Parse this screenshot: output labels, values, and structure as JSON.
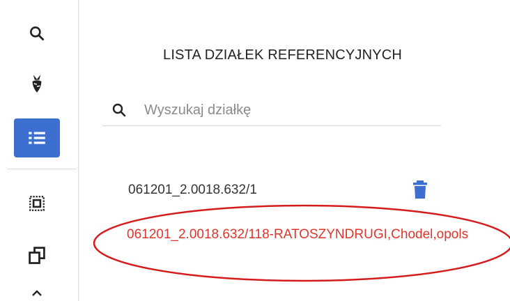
{
  "sidebar": {
    "items": [
      {
        "icon": "search-icon"
      },
      {
        "icon": "beet-icon"
      },
      {
        "icon": "list-icon",
        "active": true
      },
      {
        "icon": "select-area-icon"
      },
      {
        "icon": "duplicate-icon"
      }
    ]
  },
  "panel": {
    "title": "LISTA DZIAŁEK REFERENCYJNYCH",
    "search": {
      "placeholder": "Wyszukaj działkę",
      "value": ""
    },
    "items": [
      {
        "label": "061201_2.0018.632/1"
      },
      {
        "label": "061201_2.0018.632/118-RATOSZYNDRUGI,Chodel,opols"
      }
    ]
  },
  "colors": {
    "accent": "#3d6fd1",
    "highlight": "#e0352b",
    "annotation": "#d51b1b"
  }
}
